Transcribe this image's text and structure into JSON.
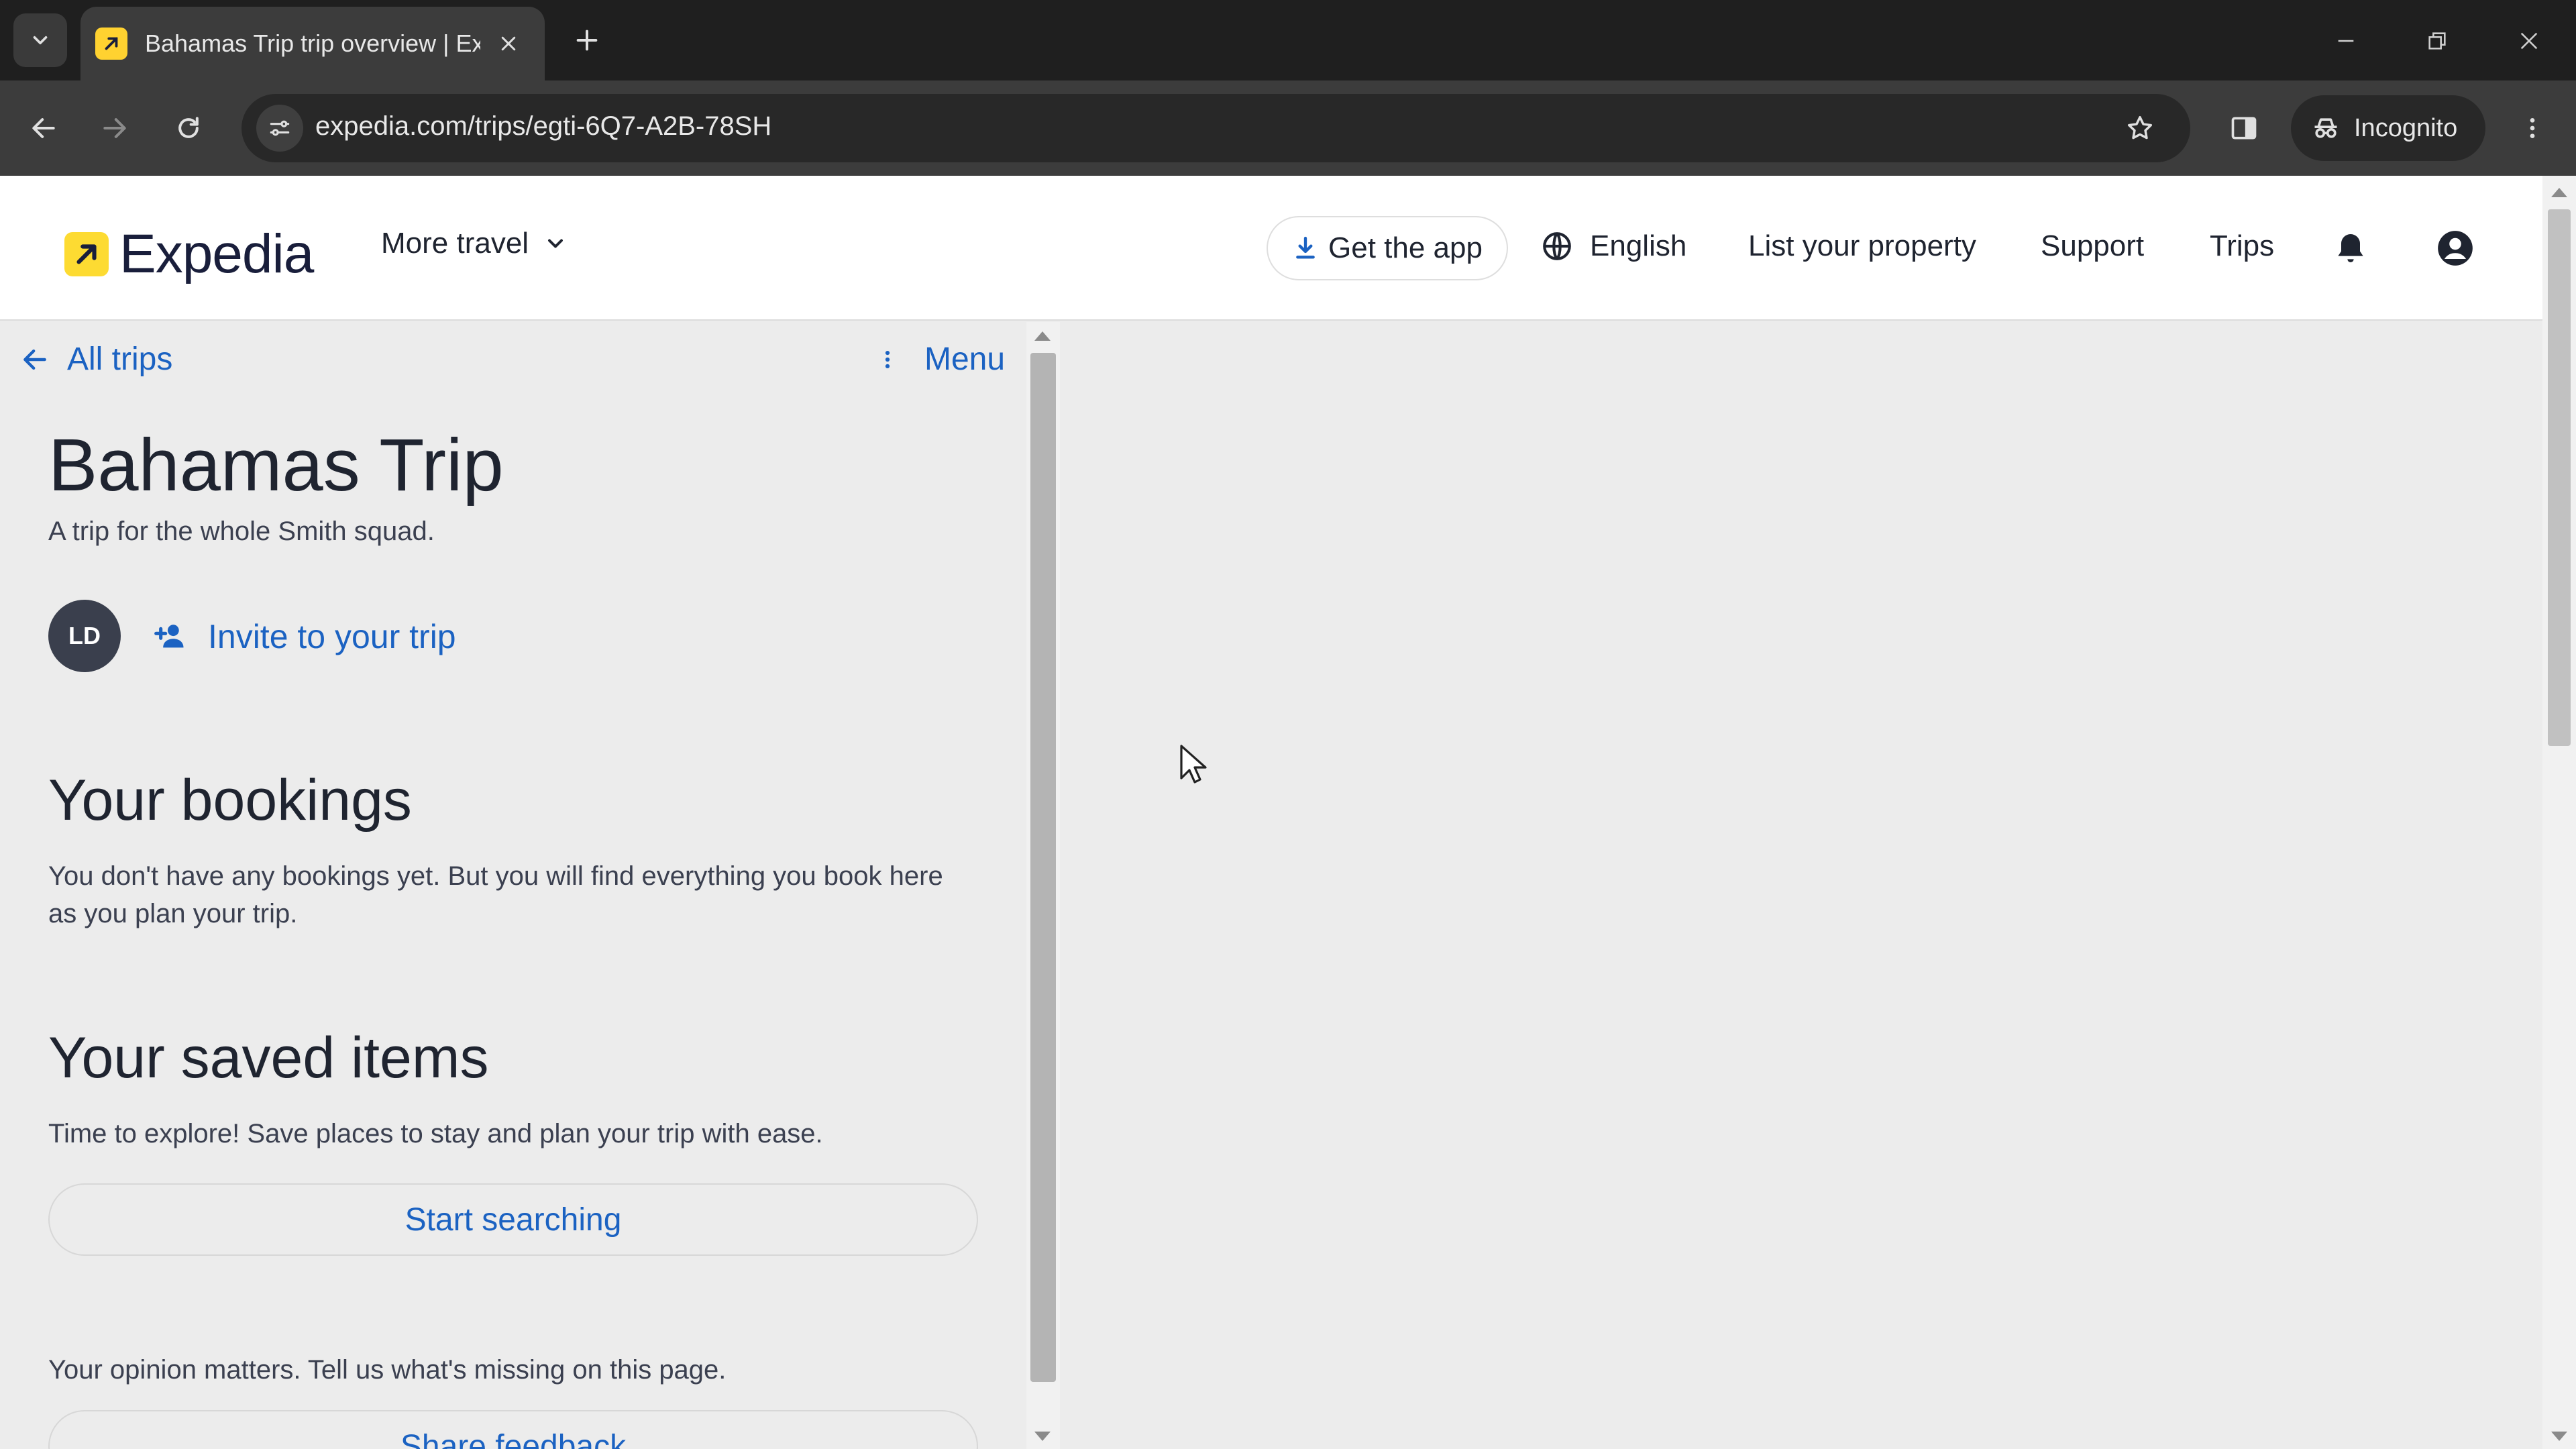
{
  "browser": {
    "tab_title": "Bahamas Trip trip overview | Exp",
    "url": "expedia.com/trips/egti-6Q7-A2B-78SH",
    "profile_label": "Incognito"
  },
  "header": {
    "logo_text": "Expedia",
    "more_travel": "More travel",
    "get_app": "Get the app",
    "language": "English",
    "list_property": "List your property",
    "support": "Support",
    "trips": "Trips"
  },
  "trip": {
    "back_label": "All trips",
    "menu_label": "Menu",
    "title": "Bahamas Trip",
    "description": "A trip for the whole Smith squad.",
    "avatar_initials": "LD",
    "invite_label": "Invite to your trip"
  },
  "bookings": {
    "heading": "Your bookings",
    "text": "You don't have any bookings yet. But you will find everything you book here as you plan your trip."
  },
  "saved": {
    "heading": "Your saved items",
    "text": "Time to explore! Save places to stay and plan your trip with ease.",
    "button": "Start searching"
  },
  "feedback": {
    "text": "Your opinion matters. Tell us what's missing on this page.",
    "button": "Share feedback"
  },
  "colors": {
    "link": "#1b62c2",
    "logo_yellow": "#fddb32",
    "logo_navy": "#191e3b"
  }
}
